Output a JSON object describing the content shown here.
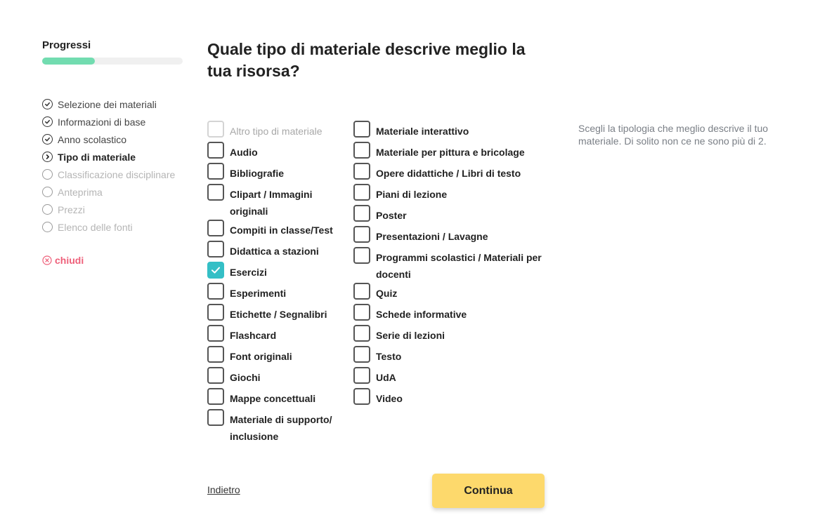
{
  "sidebar": {
    "progress_label": "Progressi",
    "progress_fraction": 0.375,
    "progress_color": "#72dcb0",
    "steps": [
      {
        "label": "Selezione dei materiali",
        "status": "done"
      },
      {
        "label": "Informazioni di base",
        "status": "done"
      },
      {
        "label": "Anno scolastico",
        "status": "done"
      },
      {
        "label": "Tipo di materiale",
        "status": "current"
      },
      {
        "label": "Classificazione disciplinare",
        "status": "pending"
      },
      {
        "label": "Anteprima",
        "status": "pending"
      },
      {
        "label": "Prezzi",
        "status": "pending"
      },
      {
        "label": "Elenco delle fonti",
        "status": "pending"
      }
    ],
    "close_label": "chiudi"
  },
  "main": {
    "question": "Quale tipo di materiale descrive meglio la tua risorsa?",
    "hint": "Scegli la tipologia che meglio descrive il tuo materiale. Di solito non ce ne sono più di 2.",
    "options_col1": [
      {
        "label": "Altro tipo di materiale",
        "checked": false,
        "disabled": true
      },
      {
        "label": "Audio",
        "checked": false
      },
      {
        "label": "Bibliografie",
        "checked": false
      },
      {
        "label": "Clipart / Immagini originali",
        "checked": false
      },
      {
        "label": "Compiti in classe/Test",
        "checked": false
      },
      {
        "label": "Didattica a stazioni",
        "checked": false
      },
      {
        "label": "Esercizi",
        "checked": true
      },
      {
        "label": "Esperimenti",
        "checked": false
      },
      {
        "label": "Etichette / Segnalibri",
        "checked": false
      },
      {
        "label": "Flashcard",
        "checked": false
      },
      {
        "label": "Font originali",
        "checked": false
      },
      {
        "label": "Giochi",
        "checked": false
      },
      {
        "label": "Mappe concettuali",
        "checked": false
      },
      {
        "label": "Materiale di supporto/ inclusione",
        "checked": false
      }
    ],
    "options_col2": [
      {
        "label": "Materiale interattivo",
        "checked": false
      },
      {
        "label": "Materiale per pittura e bricolage",
        "checked": false
      },
      {
        "label": "Opere didattiche / Libri di testo",
        "checked": false
      },
      {
        "label": "Piani di lezione",
        "checked": false
      },
      {
        "label": "Poster",
        "checked": false
      },
      {
        "label": "Presentazioni / Lavagne",
        "checked": false
      },
      {
        "label": "Programmi scolastici / Materiali per docenti",
        "checked": false
      },
      {
        "label": "Quiz",
        "checked": false
      },
      {
        "label": "Schede informative",
        "checked": false
      },
      {
        "label": "Serie di lezioni",
        "checked": false
      },
      {
        "label": "Testo",
        "checked": false
      },
      {
        "label": "UdA",
        "checked": false
      },
      {
        "label": "Video",
        "checked": false
      }
    ],
    "checked_color": "#34bfc6"
  },
  "footer": {
    "back_label": "Indietro",
    "continue_label": "Continua",
    "continue_color": "#fdd96c"
  }
}
